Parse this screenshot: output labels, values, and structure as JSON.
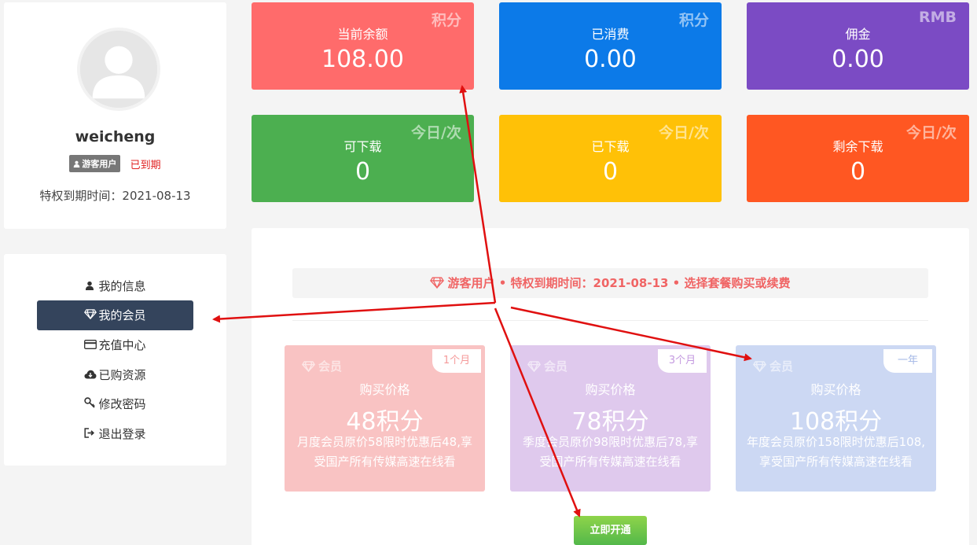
{
  "profile": {
    "username": "weicheng",
    "role_badge": "游客用户",
    "status": "已到期",
    "expire_line": "特权到期时间：2021-08-13"
  },
  "menu": [
    {
      "label": "我的信息",
      "icon": "user-icon"
    },
    {
      "label": "我的会员",
      "icon": "diamond-icon",
      "active": true
    },
    {
      "label": "充值中心",
      "icon": "credit-card-icon"
    },
    {
      "label": "已购资源",
      "icon": "cloud-download-icon"
    },
    {
      "label": "修改密码",
      "icon": "key-icon"
    },
    {
      "label": "退出登录",
      "icon": "sign-out-icon"
    }
  ],
  "stats": [
    {
      "tag": "积分",
      "label": "当前余额",
      "value": "108.00",
      "color": "#ff6b6b"
    },
    {
      "tag": "积分",
      "label": "已消费",
      "value": "0.00",
      "color": "#0c7ae8"
    },
    {
      "tag": "RMB",
      "label": "佣金",
      "value": "0.00",
      "color": "#7b4bc4"
    },
    {
      "tag": "今日/次",
      "label": "可下载",
      "value": "0",
      "color": "#4caf50"
    },
    {
      "tag": "今日/次",
      "label": "已下载",
      "value": "0",
      "color": "#ffc107"
    },
    {
      "tag": "今日/次",
      "label": "剩余下载",
      "value": "0",
      "color": "#ff5722"
    }
  ],
  "notice": "游客用户 • 特权到期时间：2021-08-13 • 选择套餐购买或续费",
  "plans": [
    {
      "tag": "会员",
      "period": "1个月",
      "price_label": "购买价格",
      "price": "48积分",
      "desc": "月度会员原价58限时优惠后48,享受国产所有传媒高速在线看",
      "color": "#f9c3c3",
      "period_color": "#f59a9a"
    },
    {
      "tag": "会员",
      "period": "3个月",
      "price_label": "购买价格",
      "price": "78积分",
      "desc": "季度会员原价98限时优惠后78,享受国产所有传媒高速在线看",
      "color": "#dfc9ed",
      "period_color": "#c49ae0"
    },
    {
      "tag": "会员",
      "period": "一年",
      "price_label": "购买价格",
      "price": "108积分",
      "desc": "年度会员原价158限时优惠后108,享受国产所有传媒高速在线看",
      "color": "#ccd8f3",
      "period_color": "#a3b7e6"
    }
  ],
  "open_button": "立即开通",
  "annotation_color": "#e01010"
}
